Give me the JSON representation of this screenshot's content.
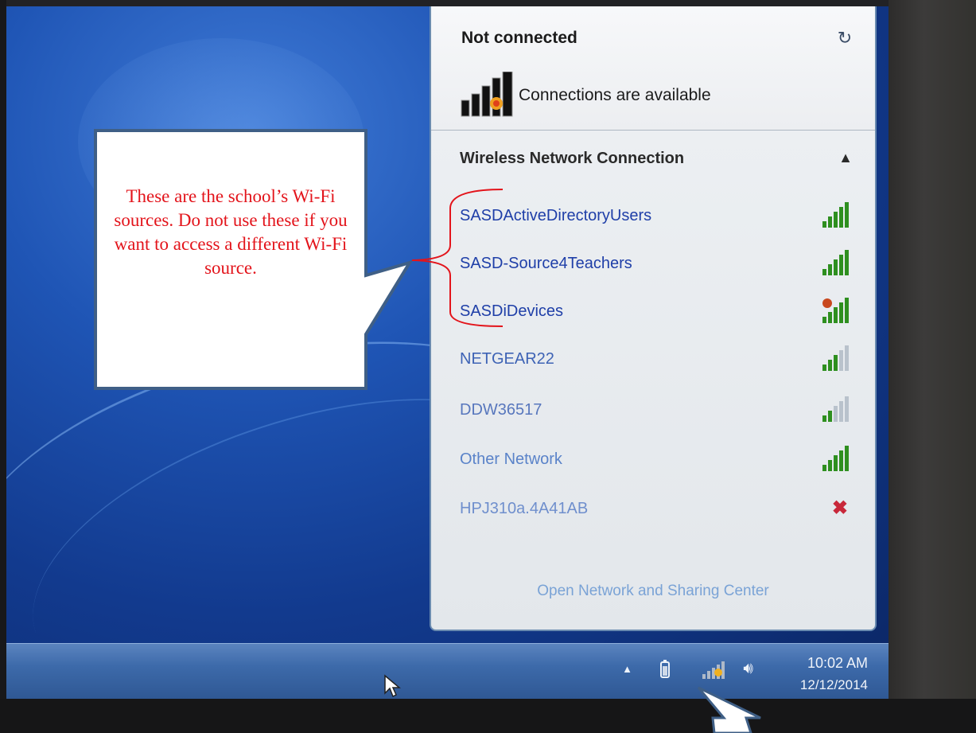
{
  "flyout": {
    "status_title": "Not connected",
    "availability": "Connections are available",
    "section_label": "Wireless Network Connection",
    "networks": [
      {
        "name": "SASDActiveDirectoryUsers",
        "signal": 5,
        "color": "#1f3fa8"
      },
      {
        "name": "SASD-Source4Teachers",
        "signal": 5,
        "color": "#1f3fa8"
      },
      {
        "name": "SASDiDevices",
        "signal": 5,
        "color": "#1f3fa8",
        "secured_warning": true
      },
      {
        "name": "NETGEAR22",
        "signal": 3,
        "color": "#3e63b5"
      },
      {
        "name": "DDW36517",
        "signal": 2,
        "color": "#5877bd"
      },
      {
        "name": "Other Network",
        "signal": 5,
        "color": "#5a83c9"
      },
      {
        "name": "HPJ310a.4A41AB",
        "signal": 0,
        "color": "#6f8fcd",
        "unavailable": true
      }
    ],
    "footer_link": "Open Network and Sharing Center"
  },
  "taskbar": {
    "time": "10:02 AM",
    "date": "12/12/2014"
  },
  "callout": {
    "text": "These are the school’s Wi-Fi sources. Do not use these if you want to access a different Wi-Fi source."
  },
  "colors": {
    "annotation": "#e3141b",
    "signal_bar": "#2e8f1f",
    "signal_bar_faded": "#b9c2cc"
  }
}
